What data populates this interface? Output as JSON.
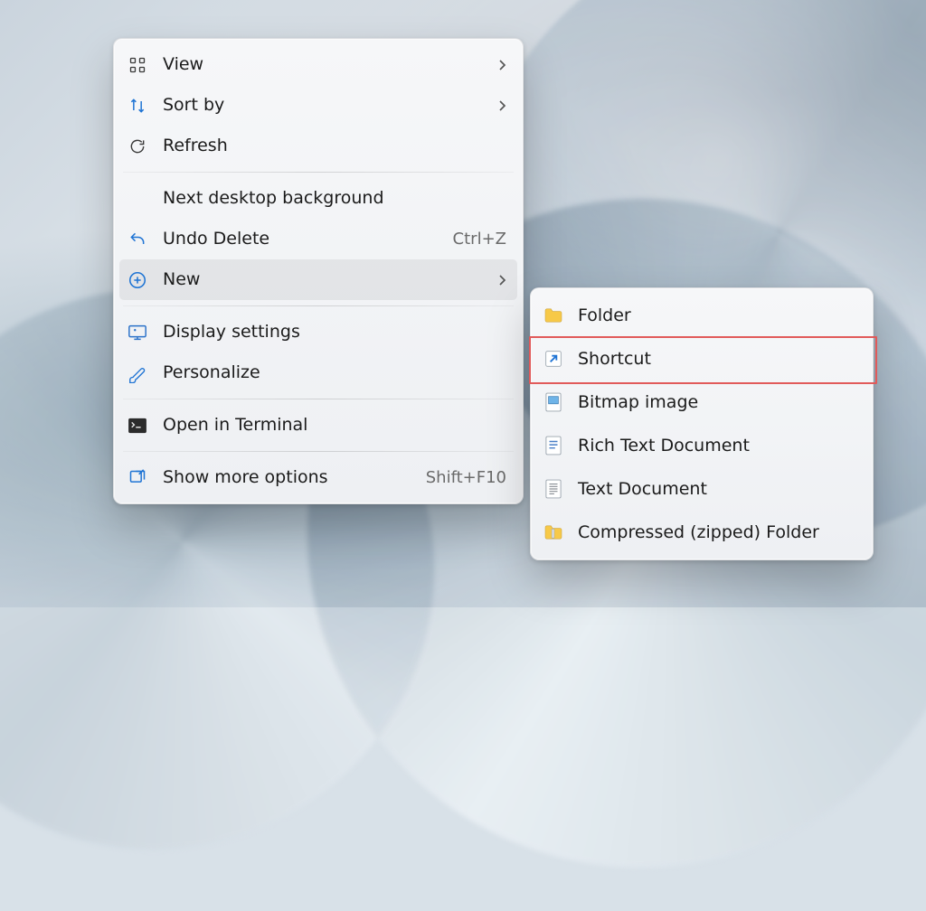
{
  "context_menu": {
    "items": [
      {
        "label": "View",
        "icon": "grid-icon",
        "submenu": true
      },
      {
        "label": "Sort by",
        "icon": "sort-icon",
        "submenu": true
      },
      {
        "label": "Refresh",
        "icon": "refresh-icon"
      },
      {
        "separator": true
      },
      {
        "label": "Next desktop background",
        "icon": null
      },
      {
        "label": "Undo Delete",
        "icon": "undo-icon",
        "accel": "Ctrl+Z"
      },
      {
        "label": "New",
        "icon": "new-icon",
        "submenu": true,
        "hovered": true
      },
      {
        "separator": true
      },
      {
        "label": "Display settings",
        "icon": "display-settings-icon"
      },
      {
        "label": "Personalize",
        "icon": "personalize-icon"
      },
      {
        "separator": true
      },
      {
        "label": "Open in Terminal",
        "icon": "terminal-icon"
      },
      {
        "separator": true
      },
      {
        "label": "Show more options",
        "icon": "show-more-icon",
        "accel": "Shift+F10"
      }
    ]
  },
  "new_submenu": {
    "items": [
      {
        "label": "Folder",
        "icon": "folder-icon"
      },
      {
        "label": "Shortcut",
        "icon": "shortcut-icon",
        "highlighted": true
      },
      {
        "label": "Bitmap image",
        "icon": "bitmap-icon"
      },
      {
        "label": "Rich Text Document",
        "icon": "rtf-icon"
      },
      {
        "label": "Text Document",
        "icon": "text-doc-icon"
      },
      {
        "label": "Compressed (zipped) Folder",
        "icon": "zip-folder-icon"
      }
    ]
  },
  "colors": {
    "accent_blue": "#1f74d4",
    "highlight_red": "#e15a5a",
    "folder_yellow": "#f7c948"
  }
}
